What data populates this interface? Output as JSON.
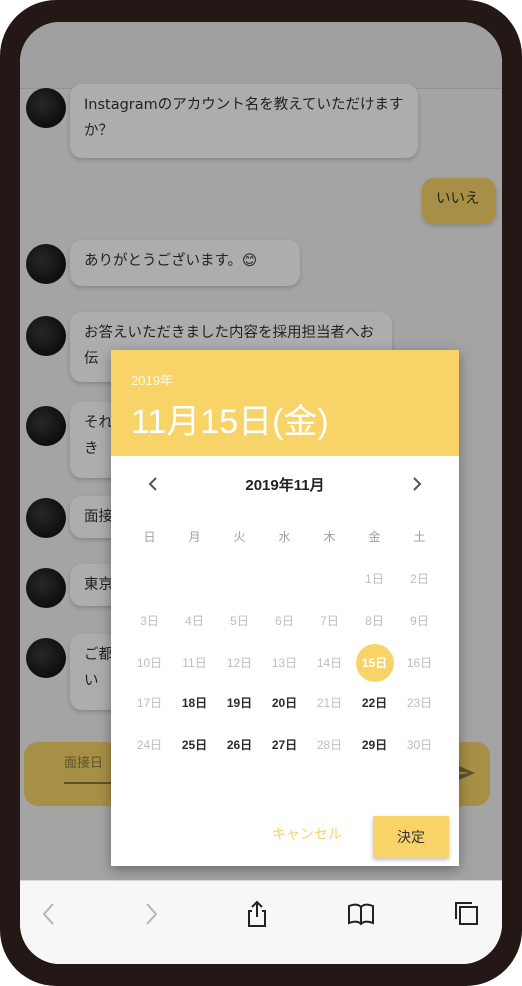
{
  "chat": {
    "messages": [
      {
        "side": "bot",
        "text": "Instagramのアカウント名を教えていただけますか？"
      },
      {
        "side": "user",
        "text": "いいえ"
      },
      {
        "side": "bot",
        "text": "ありがとうございます。😊"
      },
      {
        "side": "bot",
        "text": "お答えいただきました内容を採用担当者へお伝"
      },
      {
        "side": "bot",
        "text": "それ だき"
      },
      {
        "side": "bot",
        "text": "面接"
      },
      {
        "side": "bot",
        "text": "東京"
      },
      {
        "side": "bot",
        "text": "ご都 さい"
      }
    ],
    "input_placeholder": "面接日"
  },
  "date_picker": {
    "header_year": "2019年",
    "header_date": "11月15日(金)",
    "month_label": "2019年11月",
    "weekdays": [
      "日",
      "月",
      "火",
      "水",
      "木",
      "金",
      "土"
    ],
    "weeks": [
      [
        {
          "t": "",
          "s": "empty"
        },
        {
          "t": "",
          "s": "empty"
        },
        {
          "t": "",
          "s": "empty"
        },
        {
          "t": "",
          "s": "empty"
        },
        {
          "t": "",
          "s": "empty"
        },
        {
          "t": "1日",
          "s": "disabled"
        },
        {
          "t": "2日",
          "s": "disabled"
        }
      ],
      [
        {
          "t": "3日",
          "s": "disabled"
        },
        {
          "t": "4日",
          "s": "disabled"
        },
        {
          "t": "5日",
          "s": "disabled"
        },
        {
          "t": "6日",
          "s": "disabled"
        },
        {
          "t": "7日",
          "s": "disabled"
        },
        {
          "t": "8日",
          "s": "disabled"
        },
        {
          "t": "9日",
          "s": "disabled"
        }
      ],
      [
        {
          "t": "10日",
          "s": "disabled"
        },
        {
          "t": "11日",
          "s": "disabled"
        },
        {
          "t": "12日",
          "s": "disabled"
        },
        {
          "t": "13日",
          "s": "disabled"
        },
        {
          "t": "14日",
          "s": "disabled"
        },
        {
          "t": "15日",
          "s": "selected"
        },
        {
          "t": "16日",
          "s": "disabled"
        }
      ],
      [
        {
          "t": "17日",
          "s": "disabled"
        },
        {
          "t": "18日",
          "s": "avail"
        },
        {
          "t": "19日",
          "s": "avail"
        },
        {
          "t": "20日",
          "s": "avail"
        },
        {
          "t": "21日",
          "s": "disabled"
        },
        {
          "t": "22日",
          "s": "avail"
        },
        {
          "t": "23日",
          "s": "disabled"
        }
      ],
      [
        {
          "t": "24日",
          "s": "disabled"
        },
        {
          "t": "25日",
          "s": "avail"
        },
        {
          "t": "26日",
          "s": "avail"
        },
        {
          "t": "27日",
          "s": "avail"
        },
        {
          "t": "28日",
          "s": "disabled"
        },
        {
          "t": "29日",
          "s": "avail"
        },
        {
          "t": "30日",
          "s": "disabled"
        }
      ]
    ],
    "cancel_label": "キャンセル",
    "ok_label": "決定"
  },
  "browser_bar": {
    "icons": [
      "back-icon",
      "forward-icon",
      "share-icon",
      "bookmarks-icon",
      "tabs-icon"
    ]
  },
  "colors": {
    "accent": "#f7d368",
    "frame": "#231815"
  }
}
